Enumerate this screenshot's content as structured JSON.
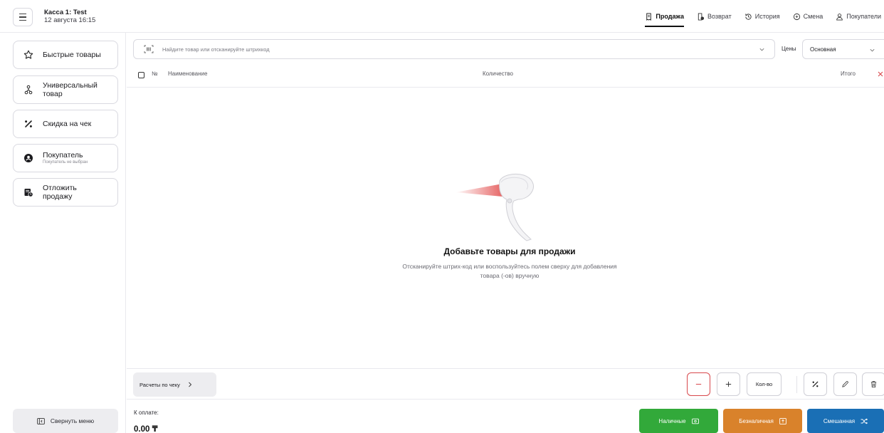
{
  "header": {
    "till_name": "Касса 1: Test",
    "datetime": "12 августа 16:15",
    "nav": [
      {
        "label": "Продажа",
        "icon": "receipt-icon",
        "active": true
      },
      {
        "label": "Возврат",
        "icon": "return-icon",
        "active": false
      },
      {
        "label": "История",
        "icon": "history-icon",
        "active": false
      },
      {
        "label": "Смена",
        "icon": "shift-icon",
        "active": false
      },
      {
        "label": "Покупатели",
        "icon": "user-icon",
        "active": false
      }
    ]
  },
  "sidebar": {
    "items": [
      {
        "label": "Быстрые товары",
        "icon": "star-icon"
      },
      {
        "label": "Универсальный товар",
        "icon": "network-icon"
      },
      {
        "label": "Скидка на чек",
        "icon": "percent-icon"
      },
      {
        "label": "Покупатель",
        "sublabel": "Покупатель не выбран",
        "icon": "customer-icon"
      },
      {
        "label": "Отложить продажу",
        "icon": "postpone-icon"
      }
    ],
    "collapse_label": "Свернуть меню"
  },
  "search": {
    "placeholder": "Найдите товар или отсканируйте штрихкод"
  },
  "prices": {
    "label": "Цены",
    "selected": "Основная"
  },
  "table": {
    "columns": {
      "number": "№",
      "name": "Наименование",
      "quantity": "Количество",
      "total": "Итого"
    }
  },
  "empty_state": {
    "title": "Добавьте товары для продажи",
    "description": "Отсканируйте штрих-код или воспользуйтесь полем сверху для добавления товара (-ов) вручную"
  },
  "actions": {
    "receipt_calc_label": "Расчеты по чеку",
    "qty_label": "Кол-во"
  },
  "payment": {
    "due_label": "К оплате:",
    "due_value": "0.00 ₸",
    "cash_label": "Наличные",
    "card_label": "Безналичная",
    "mixed_label": "Смешанная",
    "colors": {
      "cash": "#32a93a",
      "card": "#d9822b",
      "mixed": "#1a6fb5",
      "danger": "#d8484c"
    }
  }
}
